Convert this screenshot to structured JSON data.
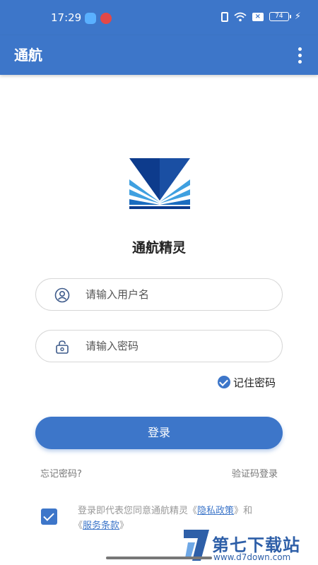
{
  "status_bar": {
    "time": "17:29",
    "battery": "74",
    "icons": [
      "weather-app-icon",
      "mail-app-icon",
      "vibrate-icon",
      "wifi-icon",
      "sim-off-icon",
      "battery-icon",
      "charging-icon"
    ]
  },
  "app_bar": {
    "title": "通航",
    "menu_icon": "more-vert-icon"
  },
  "app_name": "通航精灵",
  "login_form": {
    "username_placeholder": "请输入用户名",
    "username_value": "",
    "password_placeholder": "请输入密码",
    "password_value": "",
    "remember_label": "记住密码",
    "remember_checked": true,
    "login_label": "登录"
  },
  "links": {
    "forgot": "忘记密码?",
    "sms_login": "验证码登录"
  },
  "agreement": {
    "checked": true,
    "prefix": "登录即代表您同意通航精灵",
    "privacy": "隐私政策",
    "and": "和",
    "terms": "服务条款",
    "open_quote": "《",
    "close_quote": "》"
  },
  "watermark": {
    "cn": "第七下载站",
    "en": "www.d7down.com"
  },
  "colors": {
    "primary": "#3d76c9",
    "logo_dark": "#0d3b8c",
    "logo_light": "#3fa0e0"
  }
}
